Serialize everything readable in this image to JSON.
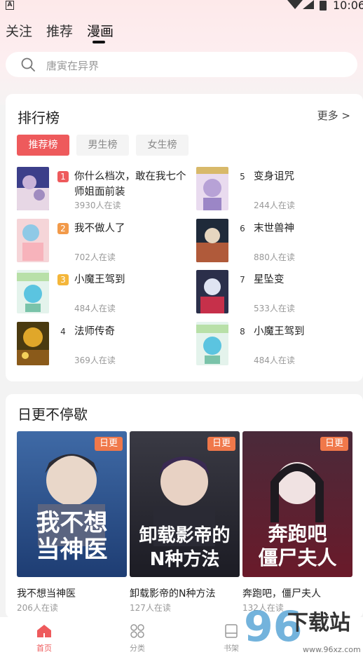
{
  "status_bar": {
    "time": "10:06",
    "notification_letter": "A"
  },
  "top_tabs": [
    {
      "label": "关注"
    },
    {
      "label": "推荐"
    },
    {
      "label": "漫画"
    }
  ],
  "search": {
    "placeholder": "唐寅在异界"
  },
  "ranking": {
    "title": "排行榜",
    "more": "更多 >",
    "tabs": [
      "推荐榜",
      "男生榜",
      "女生榜"
    ],
    "items": [
      {
        "rank": "1",
        "title": "你什么档次，敢在我七个师姐面前装",
        "readers": "3930人在读"
      },
      {
        "rank": "2",
        "title": "我不做人了",
        "readers": "702人在读"
      },
      {
        "rank": "3",
        "title": "小魔王驾到",
        "readers": "484人在读"
      },
      {
        "rank": "4",
        "title": "法师传奇",
        "readers": "369人在读"
      },
      {
        "rank": "5",
        "title": "变身诅咒",
        "readers": "244人在读"
      },
      {
        "rank": "6",
        "title": "末世兽神",
        "readers": "880人在读"
      },
      {
        "rank": "7",
        "title": "星坠变",
        "readers": "533人在读"
      },
      {
        "rank": "8",
        "title": "小魔王驾到",
        "readers": "484人在读"
      }
    ]
  },
  "daily": {
    "title": "日更不停歇",
    "badge": "日更",
    "items": [
      {
        "title": "我不想当神医",
        "readers": "206人在读",
        "cover_line1": "我不想",
        "cover_line2": "当神医"
      },
      {
        "title": "卸载影帝的N种方法",
        "readers": "127人在读",
        "cover_line1": "卸载影帝的",
        "cover_line2": "N种方法"
      },
      {
        "title": "奔跑吧，僵尸夫人",
        "readers": "132人在读",
        "cover_line1": "奔跑吧",
        "cover_line2": "僵尸夫人"
      }
    ]
  },
  "bottom_nav": [
    {
      "label": "首页",
      "icon": "home-icon"
    },
    {
      "label": "分类",
      "icon": "grid-icon"
    },
    {
      "label": "书架",
      "icon": "bookshelf-icon"
    }
  ],
  "watermark": {
    "text": "下载站",
    "number": "96",
    "url": "www.96xz.com"
  },
  "colors": {
    "accent": "#ee5a5c",
    "badge": "#f0784a"
  }
}
